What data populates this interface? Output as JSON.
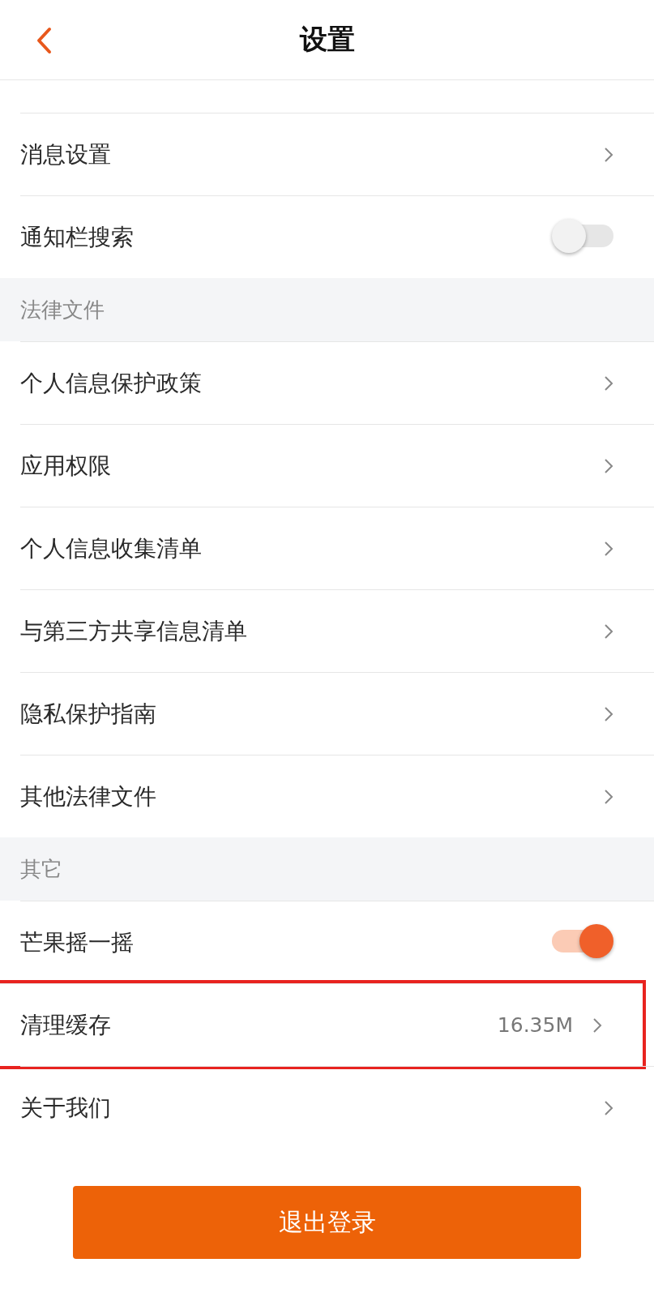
{
  "header": {
    "title": "设置"
  },
  "sections": [
    {
      "items": [
        {
          "label": "消息设置",
          "kind": "link"
        },
        {
          "label": "通知栏搜索",
          "kind": "toggle",
          "on": false
        }
      ]
    },
    {
      "title": "法律文件",
      "items": [
        {
          "label": "个人信息保护政策",
          "kind": "link"
        },
        {
          "label": "应用权限",
          "kind": "link"
        },
        {
          "label": "个人信息收集清单",
          "kind": "link"
        },
        {
          "label": "与第三方共享信息清单",
          "kind": "link"
        },
        {
          "label": "隐私保护指南",
          "kind": "link"
        },
        {
          "label": "其他法律文件",
          "kind": "link"
        }
      ]
    },
    {
      "title": "其它",
      "items": [
        {
          "label": "芒果摇一摇",
          "kind": "toggle",
          "on": true
        },
        {
          "label": "清理缓存",
          "kind": "link",
          "value": "16.35M",
          "highlighted": true
        },
        {
          "label": "关于我们",
          "kind": "link"
        }
      ]
    }
  ],
  "logout_button": "退出登录"
}
